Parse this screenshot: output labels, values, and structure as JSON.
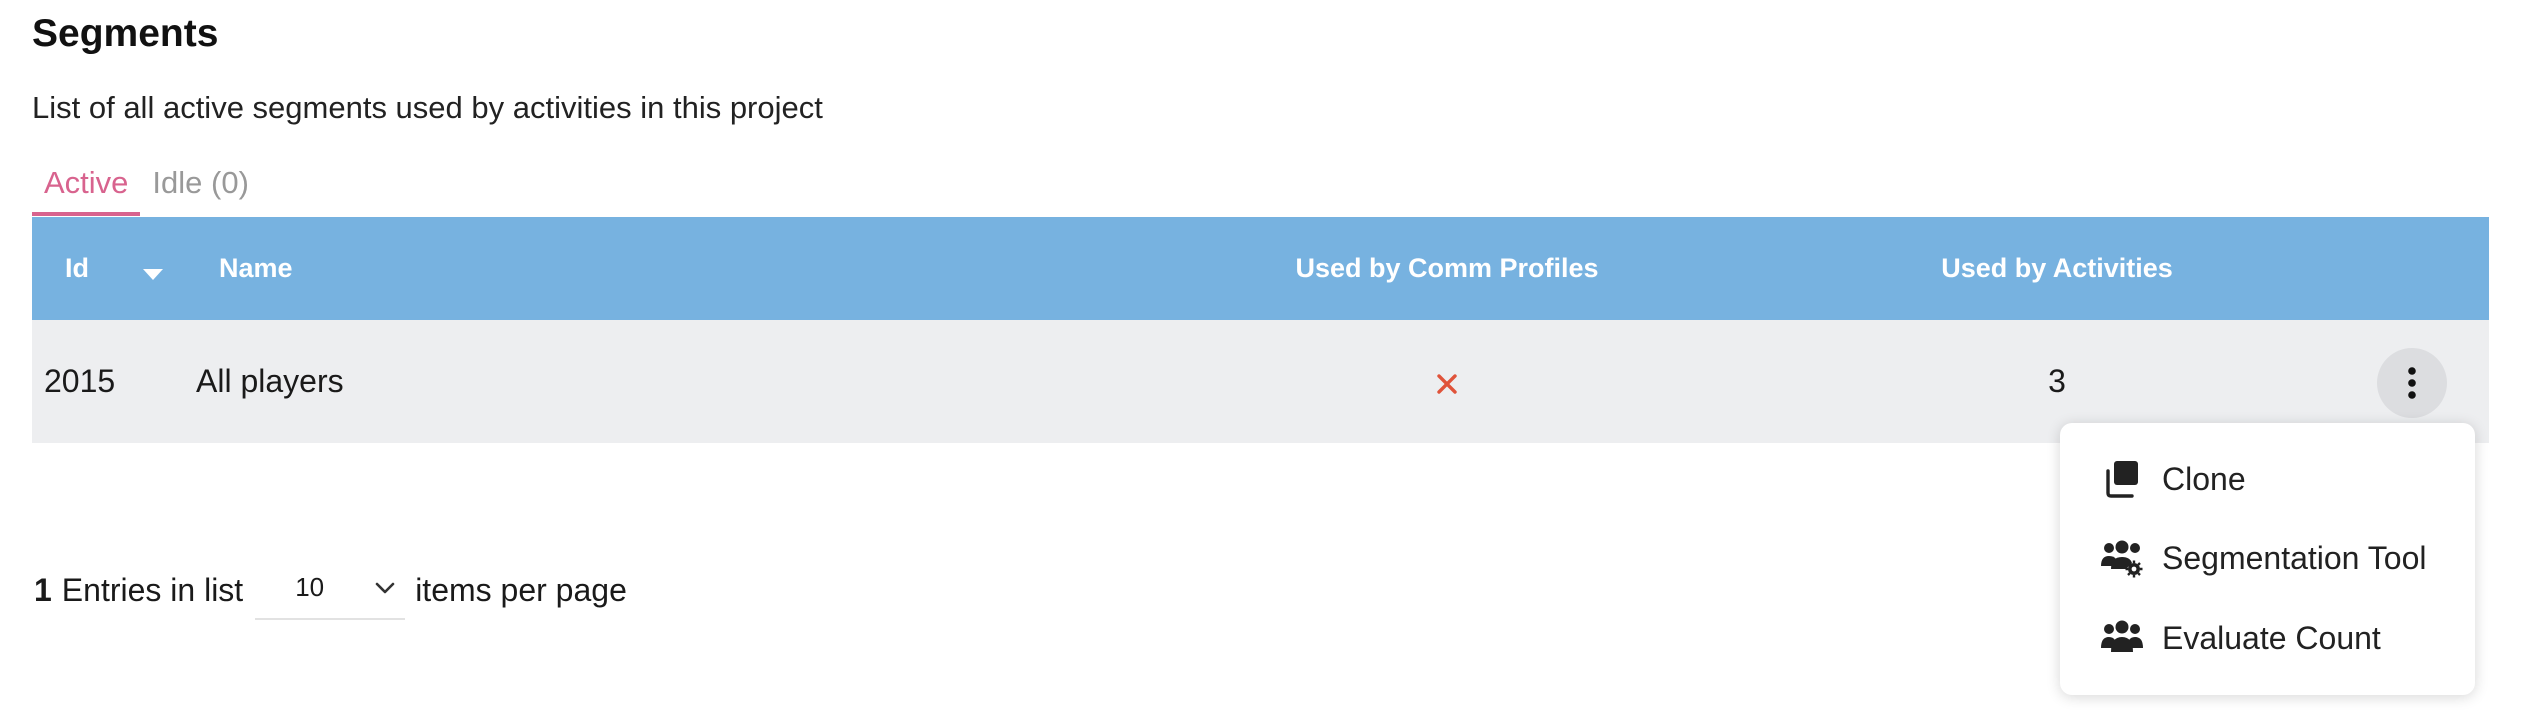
{
  "page": {
    "title": "Segments",
    "subtitle": "List of all active segments used by activities in this project"
  },
  "tabs": [
    {
      "label": "Active",
      "active": true
    },
    {
      "label": "Idle (0)",
      "active": false
    }
  ],
  "table": {
    "columns": {
      "id": "Id",
      "name": "Name",
      "comm_profiles": "Used by Comm Profiles",
      "activities": "Used by Activities"
    },
    "sort": {
      "column": "id",
      "direction": "descending",
      "icon": "caret-down-icon"
    },
    "rows": [
      {
        "id": "2015",
        "name": "All players",
        "comm_profiles_icon": "x-icon",
        "activities": "3"
      }
    ]
  },
  "row_menu": {
    "items": [
      {
        "label": "Clone",
        "icon": "clone-icon"
      },
      {
        "label": "Segmentation Tool",
        "icon": "users-gear-icon"
      },
      {
        "label": "Evaluate Count",
        "icon": "users-icon"
      }
    ]
  },
  "pagination": {
    "count": "1",
    "entries_label": "Entries in list",
    "per_page_value": "10",
    "per_page_label": "items per page"
  },
  "colors": {
    "header_bg": "#77b2e0",
    "row_bg": "#edeef0",
    "tab_active": "#d8638e",
    "x_icon": "#e0533a"
  }
}
